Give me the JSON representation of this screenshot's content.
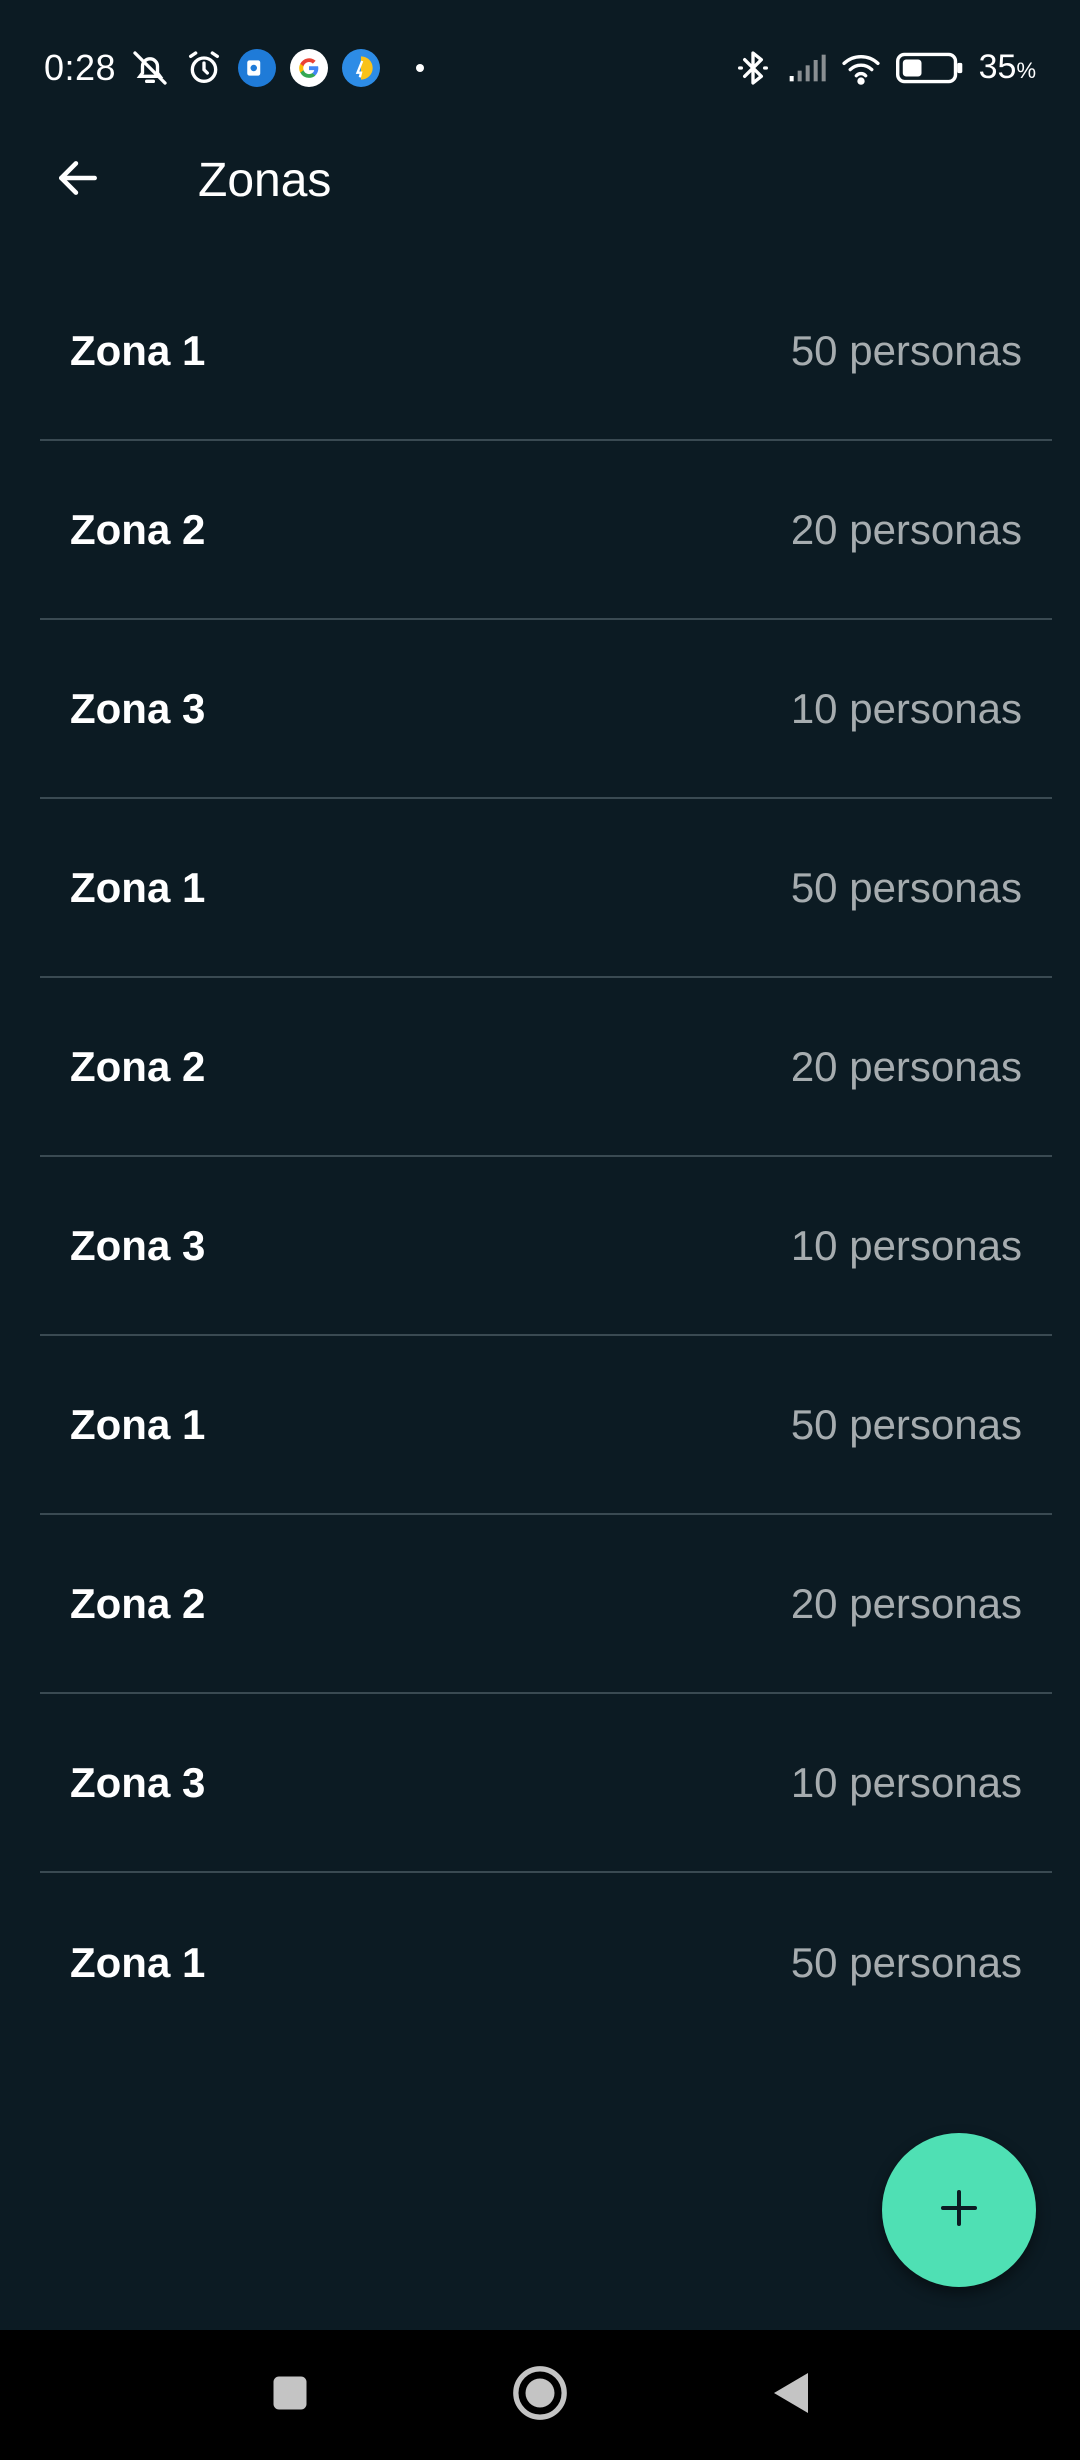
{
  "status_bar": {
    "time": "0:28",
    "battery_percent": "35",
    "battery_unit": "%",
    "icons": [
      "mute-notifications-icon",
      "alarm-icon",
      "outlook-icon",
      "google-icon",
      "app-icon",
      "bluetooth-icon",
      "signal-icon",
      "wifi-icon",
      "battery-icon"
    ]
  },
  "app_bar": {
    "title": "Zonas",
    "back_icon": "arrow-left-icon"
  },
  "zones": [
    {
      "name": "Zona 1",
      "count": "50 personas"
    },
    {
      "name": "Zona 2",
      "count": "20 personas"
    },
    {
      "name": "Zona 3",
      "count": "10 personas"
    },
    {
      "name": "Zona 1",
      "count": "50 personas"
    },
    {
      "name": "Zona 2",
      "count": "20 personas"
    },
    {
      "name": "Zona 3",
      "count": "10 personas"
    },
    {
      "name": "Zona 1",
      "count": "50 personas"
    },
    {
      "name": "Zona 2",
      "count": "20 personas"
    },
    {
      "name": "Zona 3",
      "count": "10 personas"
    },
    {
      "name": "Zona 1",
      "count": "50 personas"
    }
  ],
  "fab": {
    "icon": "plus-icon"
  },
  "colors": {
    "background": "#0c1b23",
    "accent": "#4fe0b4",
    "secondary_text": "#a6acaf",
    "divider": "#3a4a52"
  }
}
